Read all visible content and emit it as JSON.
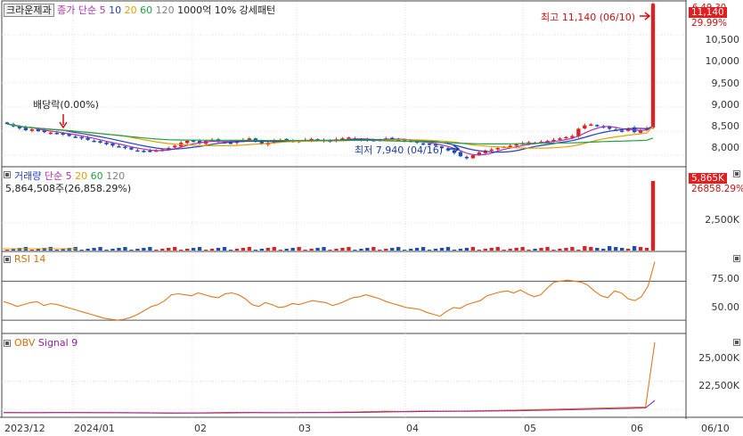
{
  "stock_name": "크라운제과",
  "price_panel": {
    "legend": {
      "label": "종가 단순",
      "ma": [
        "5",
        "10",
        "20",
        "60",
        "120"
      ],
      "pattern_text": "1000억 10% 강세패턴"
    },
    "ma_colors": [
      "#b030b0",
      "#2040c0",
      "#e0a000",
      "#20a040",
      "#808080"
    ],
    "y_ticks": [
      "10,500",
      "10,000",
      "9,500",
      "9,000",
      "8,500",
      "8,000"
    ],
    "last_price_tag": "11,140",
    "last_pct_tag": "29.99%",
    "top_clip_label": "6,49,30",
    "high_annotation": "최고 11,140 (06/10)",
    "low_annotation": "최저 7,940 (04/16)",
    "dividend_annotation": "배당락(0.00%)"
  },
  "volume_panel": {
    "legend_label": "거래량",
    "legend_ma_label": "단순",
    "legend_ma": [
      "5",
      "20",
      "60",
      "120"
    ],
    "value_text": "5,864,508주(26,858.29%)",
    "y_ticks": [
      "2,500K"
    ],
    "tag_value": "5,865K",
    "tag_pct": "26858.29%"
  },
  "rsi_panel": {
    "label": "RSI 14",
    "y_ticks": [
      "75.00",
      "50.00"
    ]
  },
  "obv_panel": {
    "label": "OBV",
    "signal_label": "Signal 9",
    "y_ticks": [
      "25,000K",
      "22,500K"
    ]
  },
  "x_axis": {
    "ticks": [
      "2023/12",
      "2024/01",
      "02",
      "03",
      "04",
      "05",
      "06",
      "06/10"
    ]
  },
  "colors": {
    "up": "#e02020",
    "down": "#1a4fb5",
    "rsi": "#e07820",
    "obv": "#e07820",
    "signal": "#9020a0",
    "grid": "#dcdcdc",
    "axis_bg": "#ffffff"
  },
  "chart_data": {
    "type": "candlestick",
    "ylim": [
      7800,
      11200
    ],
    "closes": [
      8650,
      8600,
      8560,
      8520,
      8540,
      8500,
      8480,
      8470,
      8450,
      8430,
      8400,
      8380,
      8350,
      8320,
      8300,
      8260,
      8230,
      8200,
      8180,
      8150,
      8120,
      8100,
      8090,
      8080,
      8100,
      8120,
      8150,
      8200,
      8260,
      8300,
      8280,
      8250,
      8300,
      8320,
      8290,
      8270,
      8250,
      8300,
      8320,
      8350,
      8280,
      8240,
      8260,
      8300,
      8320,
      8310,
      8290,
      8300,
      8320,
      8340,
      8310,
      8290,
      8300,
      8330,
      8350,
      8370,
      8340,
      8320,
      8300,
      8310,
      8330,
      8350,
      8340,
      8320,
      8300,
      8280,
      8260,
      8240,
      8220,
      8200,
      8150,
      8100,
      8050,
      7980,
      7940,
      8000,
      8060,
      8100,
      8120,
      8150,
      8180,
      8200,
      8230,
      8250,
      8270,
      8260,
      8280,
      8300,
      8320,
      8350,
      8380,
      8400,
      8550,
      8620,
      8640,
      8600,
      8580,
      8550,
      8520,
      8500,
      8560,
      8480,
      8520,
      8560,
      11140
    ],
    "rsi": [
      49,
      47,
      44,
      46,
      48,
      49,
      45,
      47,
      46,
      44,
      42,
      40,
      38,
      36,
      34,
      32,
      31,
      30,
      31,
      33,
      36,
      40,
      44,
      46,
      50,
      56,
      57,
      56,
      55,
      58,
      56,
      54,
      53,
      57,
      58,
      56,
      52,
      46,
      44,
      48,
      46,
      43,
      44,
      47,
      46,
      48,
      50,
      49,
      48,
      45,
      47,
      50,
      53,
      54,
      56,
      54,
      52,
      49,
      47,
      45,
      43,
      42,
      41,
      38,
      36,
      34,
      39,
      43,
      42,
      46,
      48,
      50,
      55,
      57,
      59,
      60,
      58,
      61,
      57,
      54,
      56,
      63,
      69,
      70,
      71,
      70,
      69,
      66,
      60,
      55,
      53,
      60,
      58,
      52,
      50,
      54,
      65,
      90
    ],
    "obv": [
      22200,
      22195,
      22190,
      22185,
      22190,
      22200,
      22210,
      22205,
      22200,
      22195,
      22190,
      22185,
      22180,
      22175,
      22170,
      22165,
      22160,
      22155,
      22150,
      22160,
      22170,
      22180,
      22190,
      22200,
      22210,
      22220,
      22210,
      22200,
      22190,
      22185,
      22180,
      22190,
      22200,
      22210,
      22220,
      22230,
      22240,
      22250,
      22260,
      22280,
      22300,
      22320,
      22310,
      22300,
      22320,
      22340,
      22330,
      22320,
      22330,
      22340,
      22350,
      22360,
      22370,
      22390,
      22400,
      22420,
      22440,
      22460,
      22480,
      22500,
      22520,
      22540,
      22560,
      22580,
      22600,
      22620,
      22640,
      22660,
      22680,
      22700,
      28500
    ],
    "annotations": [
      "최고 11,140 (06/10)",
      "최저 7,940 (04/16)",
      "배당락(0.00%)"
    ]
  }
}
